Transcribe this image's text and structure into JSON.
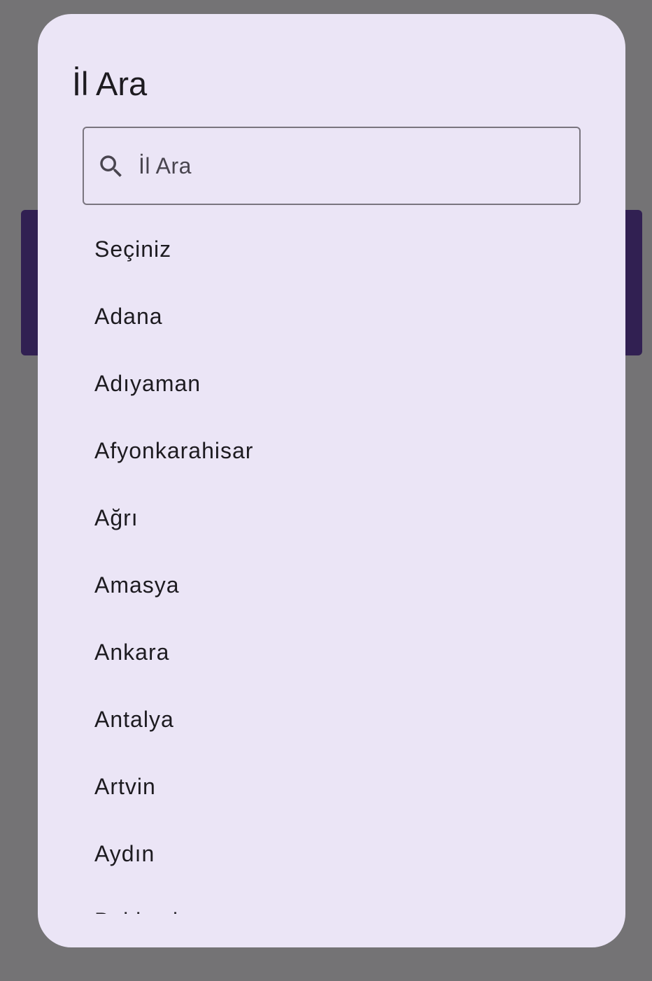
{
  "dialog": {
    "title": "İl Ara"
  },
  "search": {
    "placeholder": "İl Ara",
    "value": "",
    "icon": "search-icon"
  },
  "cities": [
    "Seçiniz",
    "Adana",
    "Adıyaman",
    "Afyonkarahisar",
    "Ağrı",
    "Amasya",
    "Ankara",
    "Antalya",
    "Artvin",
    "Aydın",
    "Balıkesir"
  ],
  "colors": {
    "scrim": "#747375",
    "banner": "#312052",
    "dialog_surface": "#ebe5f6",
    "outline": "#7a757f",
    "text_primary": "#1d1b20",
    "text_secondary": "#49454f"
  }
}
